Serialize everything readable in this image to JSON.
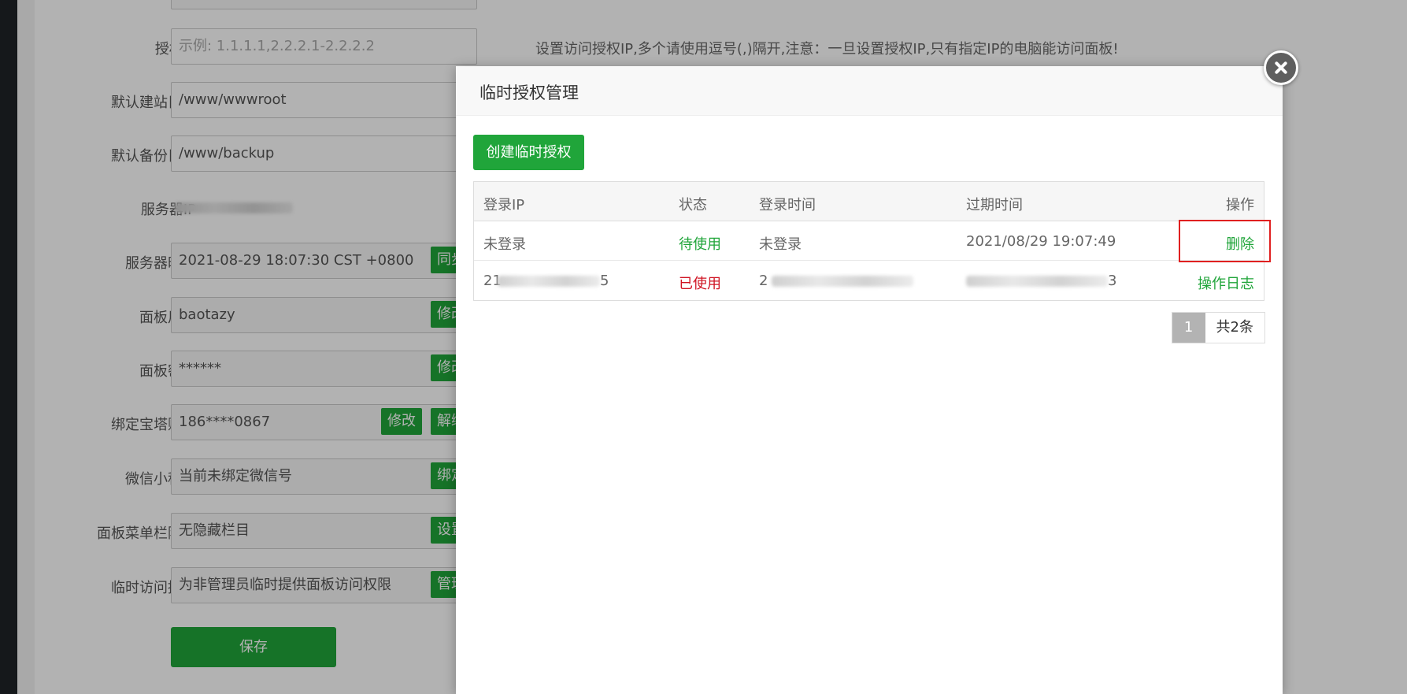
{
  "form": {
    "auth_ip": {
      "label": "授权IP",
      "placeholder": "示例: 1.1.1.1,2.2.2.1-2.2.2.2",
      "hint": "设置访问授权IP,多个请使用逗号(,)隔开,注意：一旦设置授权IP,只有指定IP的电脑能访问面板!"
    },
    "site_dir": {
      "label": "默认建站目录",
      "value": "/www/wwwroot"
    },
    "backup_dir": {
      "label": "默认备份目录",
      "value": "/www/backup"
    },
    "server_ip": {
      "label": "服务器IP"
    },
    "server_time": {
      "label": "服务器时间",
      "value": "2021-08-29 18:07:30 CST +0800",
      "button": "同步"
    },
    "panel_user": {
      "label": "面板用户",
      "value": "baotazy",
      "button": "修改"
    },
    "panel_pass": {
      "label": "面板密码",
      "value": "******",
      "button": "修改"
    },
    "bt_account": {
      "label": "绑定宝塔账号",
      "value": "186****0867",
      "button1": "修改",
      "button2": "解绑"
    },
    "wechat": {
      "label": "微信小程序",
      "value": "当前未绑定微信号",
      "button": "绑定"
    },
    "menu_hide": {
      "label": "面板菜单栏隐藏",
      "value": "无隐藏栏目",
      "button": "设置"
    },
    "temp_auth": {
      "label": "临时访问授权",
      "value": "为非管理员临时提供面板访问权限",
      "button": "管理"
    },
    "save_label": "保存"
  },
  "modal": {
    "title": "临时授权管理",
    "create_label": "创建临时授权",
    "columns": [
      "登录IP",
      "状态",
      "登录时间",
      "过期时间",
      "操作"
    ],
    "rows": [
      {
        "ip": "未登录",
        "status": "待使用",
        "login_time": "未登录",
        "expire": "2021/08/29 19:07:49",
        "action": "删除"
      },
      {
        "ip": "21",
        "ip_tail": "5",
        "status": "已使用",
        "login_time": "2",
        "expire": "",
        "expire_tail": "3",
        "action": "操作日志"
      }
    ],
    "pager": {
      "current": "1",
      "total": "共2条"
    }
  },
  "colors": {
    "accent": "#20a53a",
    "used": "#cf1322",
    "highlight": "#e02020"
  }
}
